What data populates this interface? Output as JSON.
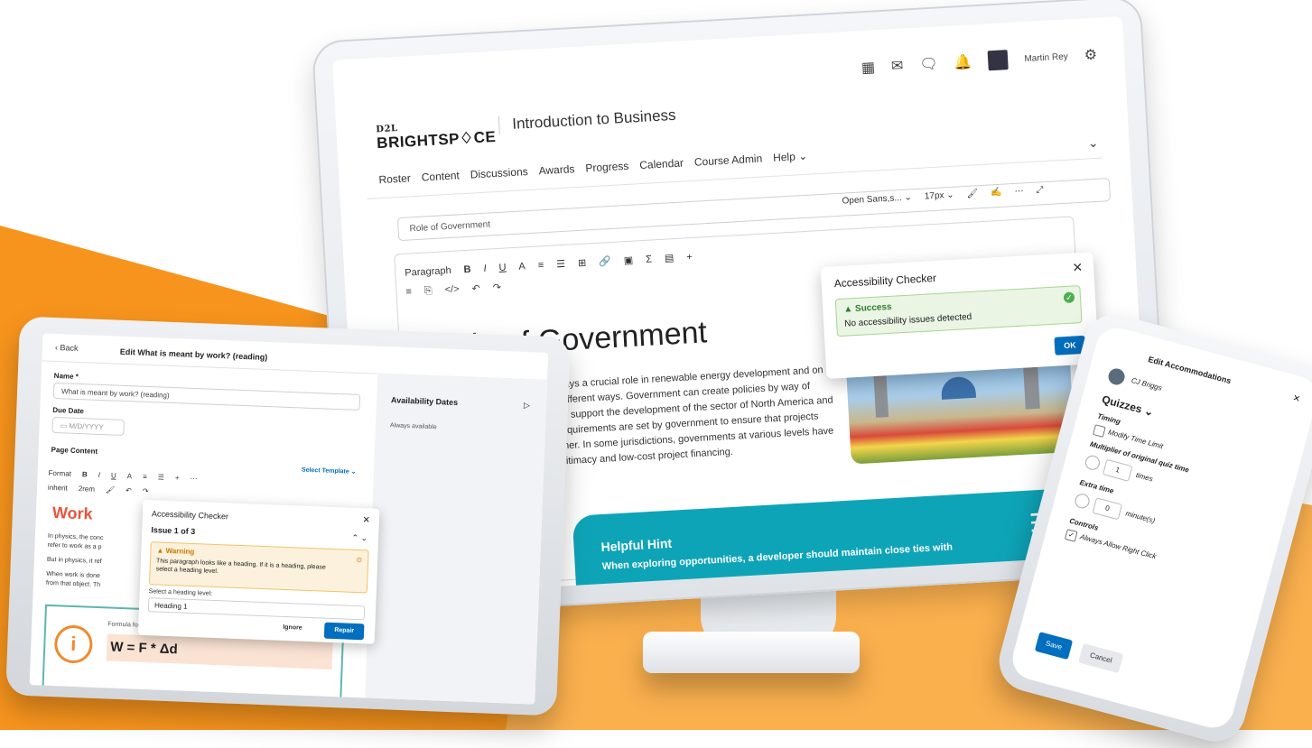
{
  "colors": {
    "orange": "#f7941d",
    "orange_light": "#fbb04e",
    "primary_blue": "#006fbf",
    "teal": "#0ea4b8",
    "success_green": "#2e7d32",
    "warning_amber": "#c77a00"
  },
  "monitor": {
    "logo_line1": "D2L",
    "logo_line2": "BRIGHTSP♢CE",
    "course_title": "Introduction to Business",
    "user_name": "Martin Rey",
    "header_icons": [
      "waffle-icon",
      "mail-icon",
      "chat-icon",
      "bell-icon",
      "gear-icon"
    ],
    "nav": [
      "Roster",
      "Content",
      "Discussions",
      "Awards",
      "Progress",
      "Calendar",
      "Course Admin",
      "Help ⌄"
    ],
    "title_field": "Role of Government",
    "font_select": "Open Sans,s... ⌄",
    "size_select": "17px ⌄",
    "format_select": "Paragraph",
    "heading": "Role of Government",
    "paragraph": "As mentioned, government plays a crucial role in renewable energy development and on that can manifest in several different ways. Government can create policies by way of targets and provide funding to support the development of the sector of North America and Europe. Further, permitting requirements are set by government to ensure that projects are developed in a safe manner. In some jurisdictions, governments at various levels have taken on projects, adding legitimacy and low-cost project financing.",
    "accessibility": {
      "title": "Accessibility Checker",
      "status": "Success",
      "message": "No accessibility issues detected",
      "ok": "OK"
    },
    "hint": {
      "title": "Helpful Hint",
      "body": "When exploring opportunities, a developer should maintain close ties with"
    }
  },
  "tablet": {
    "back": "Back",
    "page_title": "Edit What is meant by work? (reading)",
    "name_label": "Name *",
    "name_value": "What is meant by work? (reading)",
    "due_label": "Due Date",
    "due_placeholder": "M/D/YYYY",
    "content_label": "Page Content",
    "select_template": "Select Template ⌄",
    "format_select": "Format",
    "inherit_select": "inherit",
    "size_select": "2rem",
    "side_title": "Availability Dates",
    "side_sub": "Always available",
    "work_heading": "Work",
    "para1": "In physics, the conc",
    "para1b": "refer to work as a p",
    "para2": "But in physics, it ref",
    "para3": "When work is done",
    "para3b": "from that object. Th",
    "formula_label": "Formula for work:",
    "formula": "W = F * Δd",
    "accessibility": {
      "title": "Accessibility Checker",
      "issue": "Issue 1 of 3",
      "warning_title": "Warning",
      "warning_msg": "This paragraph looks like a heading. If it is a heading, please select a heading level.",
      "select_label": "Select a heading level:",
      "select_value": "Heading 1",
      "ignore": "Ignore",
      "repair": "Repair"
    }
  },
  "phone": {
    "title": "Edit Accommodations",
    "user": "CJ Briggs",
    "section": "Quizzes ⌄",
    "timing": "Timing",
    "modify_time": "Modify Time Limit",
    "multiplier": "Multiplier of original quiz time",
    "multiplier_value": "1",
    "times": "times",
    "extra_time": "Extra time",
    "extra_value": "0",
    "minutes": "minute(s)",
    "controls": "Controls",
    "allow_right_click": "Always Allow Right Click",
    "save": "Save",
    "cancel": "Cancel"
  }
}
